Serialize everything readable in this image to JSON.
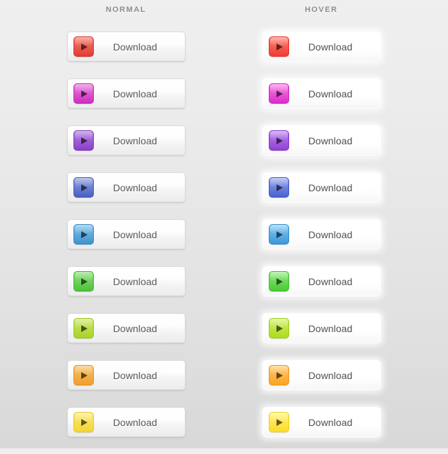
{
  "headers": {
    "normal": "NORMAL",
    "hover": "HOVER"
  },
  "button_label": "Download",
  "icon": "play-triangle-icon",
  "colors": {
    "page_bg_top": "#efefef",
    "page_bg_bottom": "#d8d8d8",
    "header_text": "#8b8b8d",
    "label_text": "#58585a"
  },
  "rows": [
    {
      "name": "red",
      "label": "Download",
      "icon_color_top": "#f2796f",
      "icon_color_bottom": "#e03d33",
      "icon_border": "#d1332a"
    },
    {
      "name": "magenta",
      "label": "Download",
      "icon_color_top": "#e87ada",
      "icon_color_bottom": "#cf2fc0",
      "icon_border": "#bf25b0"
    },
    {
      "name": "purple",
      "label": "Download",
      "icon_color_top": "#b27fe0",
      "icon_color_bottom": "#8a40c9",
      "icon_border": "#7c34b9"
    },
    {
      "name": "indigo",
      "label": "Download",
      "icon_color_top": "#8e9ee0",
      "icon_color_bottom": "#4a5fc4",
      "icon_border": "#3f53b4"
    },
    {
      "name": "sky-blue",
      "label": "Download",
      "icon_color_top": "#7fc0e8",
      "icon_color_bottom": "#3e93ce",
      "icon_border": "#3484bd"
    },
    {
      "name": "green",
      "label": "Download",
      "icon_color_top": "#8be07a",
      "icon_color_bottom": "#4ec23a",
      "icon_border": "#44b231"
    },
    {
      "name": "lime",
      "label": "Download",
      "icon_color_top": "#cbe66a",
      "icon_color_bottom": "#a8d425",
      "icon_border": "#98c41d"
    },
    {
      "name": "orange",
      "label": "Download",
      "icon_color_top": "#f8c06a",
      "icon_color_bottom": "#f0a02a",
      "icon_border": "#e09120"
    },
    {
      "name": "yellow",
      "label": "Download",
      "icon_color_top": "#fae97a",
      "icon_color_bottom": "#f4d631",
      "icon_border": "#e6c723"
    }
  ],
  "states": [
    {
      "key": "normal",
      "title": "NORMAL"
    },
    {
      "key": "hover",
      "title": "HOVER"
    }
  ]
}
